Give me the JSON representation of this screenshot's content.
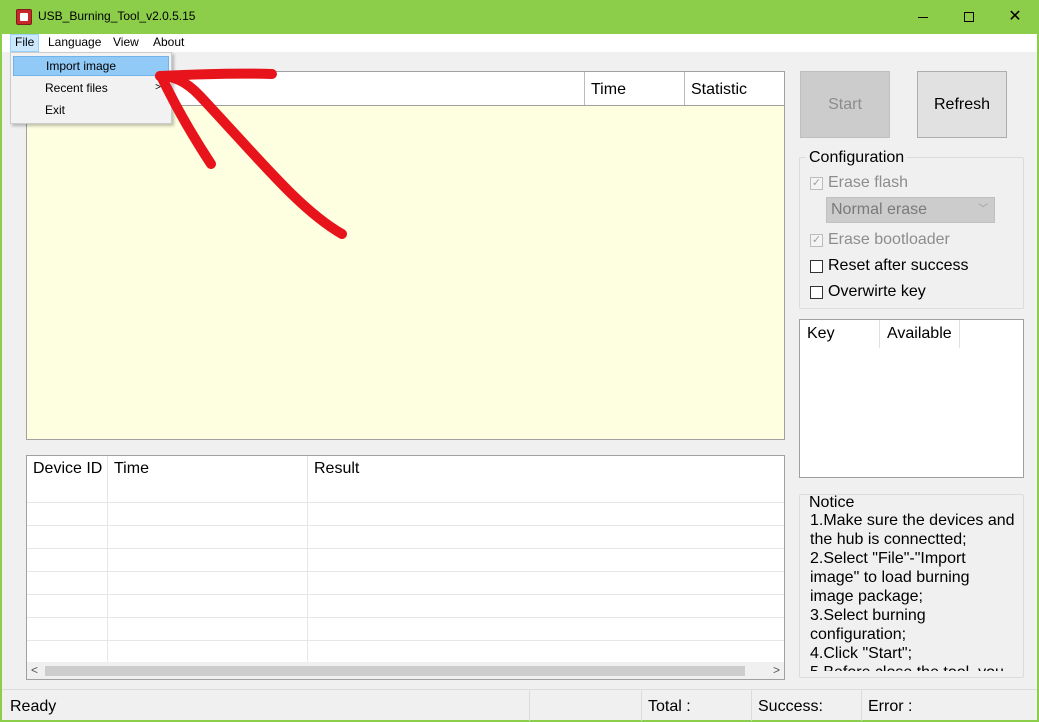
{
  "window": {
    "title": "USB_Burning_Tool_v2.0.5.15",
    "controls": {
      "minimize": "minimize-icon",
      "maximize": "maximize-icon",
      "close": "close-icon"
    }
  },
  "menubar": {
    "items": [
      "File",
      "Language",
      "View",
      "About"
    ]
  },
  "file_menu": {
    "items": [
      {
        "label": "Import image",
        "highlighted": true
      },
      {
        "label": "Recent files",
        "has_submenu": true
      },
      {
        "label": "Exit"
      }
    ]
  },
  "device_list": {
    "columns": [
      "Time",
      "Statistic"
    ]
  },
  "log_table": {
    "columns": [
      "Device ID",
      "Time",
      "Result"
    ],
    "rows": []
  },
  "buttons": {
    "start": "Start",
    "refresh": "Refresh"
  },
  "configuration": {
    "title": "Configuration",
    "erase_flash": {
      "label": "Erase flash",
      "checked": true,
      "disabled": true
    },
    "erase_mode": {
      "value": "Normal erase",
      "disabled": true
    },
    "erase_bootloader": {
      "label": "Erase bootloader",
      "checked": true,
      "disabled": true
    },
    "reset_after_success": {
      "label": "Reset after success",
      "checked": false
    },
    "overwrite_key": {
      "label": "Overwirte key",
      "checked": false
    }
  },
  "key_list": {
    "columns": [
      "Key",
      "Available"
    ]
  },
  "notice": {
    "title": "Notice",
    "text": "1.Make sure the devices and the hub is connectted;\n2.Select \"File\"-\"Import image\" to load burning image package;\n3.Select burning configuration;\n4.Click \"Start\";\n5.Before close the tool, you"
  },
  "statusbar": {
    "ready": "Ready",
    "total": "Total :",
    "success": "Success:",
    "error": "Error :"
  },
  "colors": {
    "title_bar": "#8ccd4a",
    "device_list_bg": "#fefee0",
    "menu_highlight": "#91c9f7",
    "annotation_arrow": "#e8141b"
  }
}
